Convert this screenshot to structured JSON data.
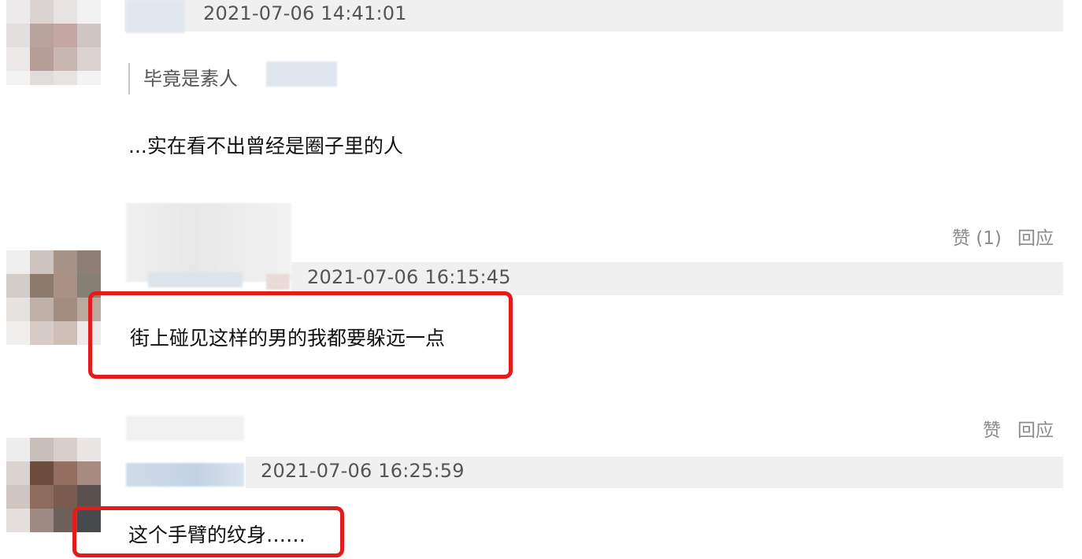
{
  "comments": [
    {
      "timestamp": "2021-07-06 14:41:01",
      "quote": "毕竟是素人",
      "text": "...实在看不出曾经是圈子里的人"
    },
    {
      "like_label": "赞 (1)",
      "reply_label": "回应",
      "timestamp": "2021-07-06 16:15:45",
      "text": "街上碰见这样的男的我都要躲远一点"
    },
    {
      "like_label": "赞",
      "reply_label": "回应",
      "timestamp": "2021-07-06 16:25:59",
      "text": "这个手臂的纹身……"
    }
  ],
  "colors": {
    "highlight_border": "#e31b1b",
    "meta_band": "#f0f0f1",
    "action_text": "#8b8b8b"
  },
  "icons": [
    "avatar-blurred"
  ]
}
